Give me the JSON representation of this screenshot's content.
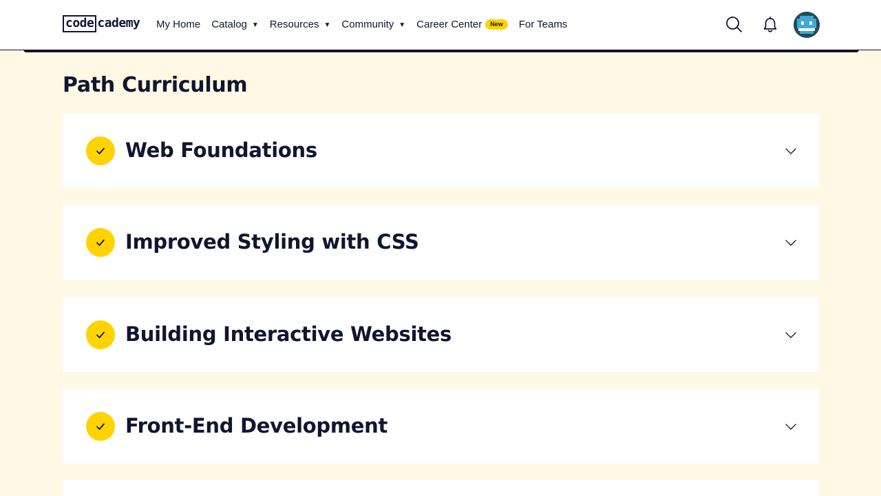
{
  "header": {
    "logo": {
      "boxed": "code",
      "rest": "cademy"
    },
    "nav": [
      {
        "label": "My Home",
        "has_dropdown": false
      },
      {
        "label": "Catalog",
        "has_dropdown": true
      },
      {
        "label": "Resources",
        "has_dropdown": true
      },
      {
        "label": "Community",
        "has_dropdown": true
      },
      {
        "label": "Career Center",
        "has_dropdown": false,
        "badge": "New"
      },
      {
        "label": "For Teams",
        "has_dropdown": false
      }
    ],
    "icons": [
      "search-icon",
      "bell-icon",
      "avatar"
    ]
  },
  "main": {
    "title": "Path Curriculum",
    "modules": [
      {
        "title": "Web Foundations",
        "completed": true
      },
      {
        "title": "Improved Styling with CSS",
        "completed": true
      },
      {
        "title": "Building Interactive Websites",
        "completed": true
      },
      {
        "title": "Front-End Development",
        "completed": true
      }
    ]
  },
  "colors": {
    "background": "#FFF8E5",
    "navy": "#10162F",
    "accent_yellow": "#FFD300",
    "card": "#FFFFFF"
  }
}
